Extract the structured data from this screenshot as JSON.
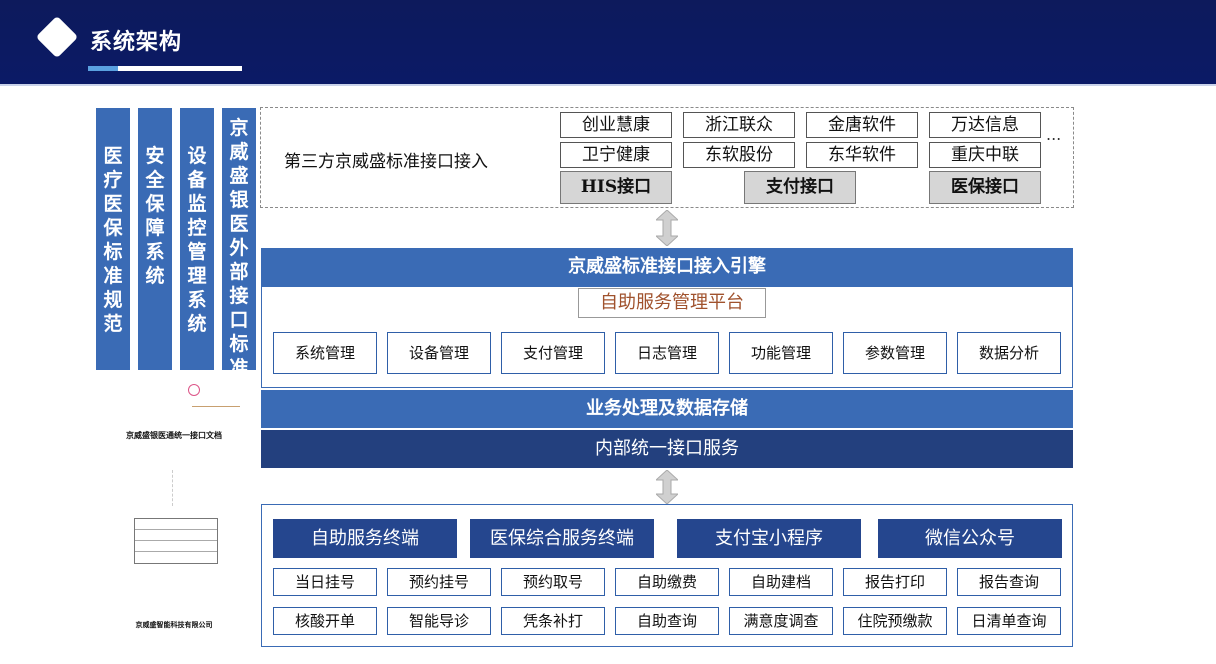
{
  "header": {
    "title": "系统架构"
  },
  "side_columns": [
    {
      "label": "医疗医保标准规范"
    },
    {
      "label": "安全保障系统"
    },
    {
      "label": "设备监控管理系统"
    },
    {
      "label": "京威盛银医外部接口标准"
    }
  ],
  "third_party": {
    "label": "第三方京威盛标准接口接入",
    "vendors": [
      "创业慧康",
      "浙江联众",
      "金唐软件",
      "万达信息",
      "卫宁健康",
      "东软股份",
      "东华软件",
      "重庆中联"
    ],
    "more": "...",
    "interfaces": [
      "HIS接口",
      "支付接口",
      "医保接口"
    ]
  },
  "engine": {
    "title": "京威盛标准接口接入引擎",
    "platform": "自助服务管理平台",
    "modules": [
      "系统管理",
      "设备管理",
      "支付管理",
      "日志管理",
      "功能管理",
      "参数管理",
      "数据分析"
    ]
  },
  "business_layer": "业务处理及数据存储",
  "internal_layer": "内部统一接口服务",
  "terminals": [
    "自助服务终端",
    "医保综合服务终端",
    "支付宝小程序",
    "微信公众号"
  ],
  "services": [
    "当日挂号",
    "预约挂号",
    "预约取号",
    "自助缴费",
    "自助建档",
    "报告打印",
    "报告查询",
    "核酸开单",
    "智能导诊",
    "凭条补打",
    "自助查询",
    "满意度调查",
    "住院预缴款",
    "日清单查询"
  ],
  "document": {
    "title": "京威盛银医通统一接口文档",
    "company": "京威盛智能科技有限公司"
  }
}
